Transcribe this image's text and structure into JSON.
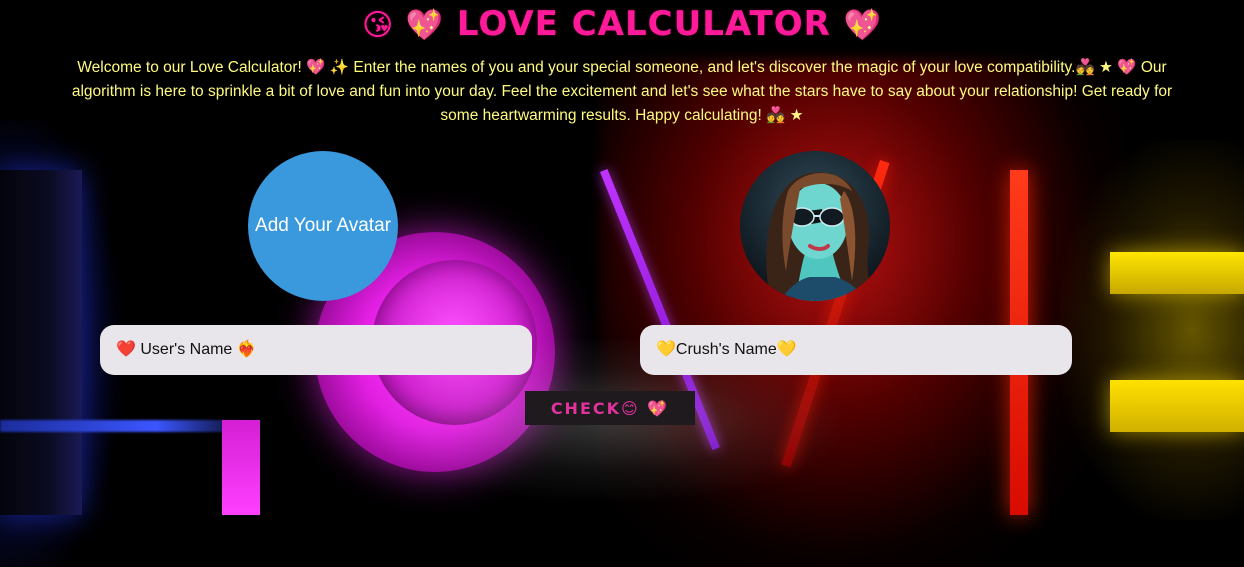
{
  "header": {
    "title_prefix": "😘 💖",
    "title_text": "LOVE CALCULATOR",
    "title_suffix": "💖"
  },
  "intro": {
    "text": "Welcome to our Love Calculator! 💖 ✨ Enter the names of you and your special someone, and let's discover the magic of your love compatibility.💑 ★ 💖 Our algorithm is here to sprinkle a bit of love and fun into your day. Feel the excitement and let's see what the stars have to say about your relationship! Get ready for some heartwarming results. Happy calculating! 💑 ★"
  },
  "avatars": {
    "user_label": "Add Your Avatar",
    "crush_image": "crush-avatar-illustration"
  },
  "inputs": {
    "user_placeholder": "❤️ User's Name ❤️‍🔥",
    "crush_placeholder": "💛Crush's Name💛"
  },
  "actions": {
    "check_label": "CHECK😊 💖"
  },
  "colors": {
    "title": "#ff1a9a",
    "intro_text": "#fffb80",
    "avatar_button": "#3a98dc",
    "input_bg": "#e8e6ea",
    "check_text": "#e0339e",
    "check_bg": "#1e1a1e"
  }
}
